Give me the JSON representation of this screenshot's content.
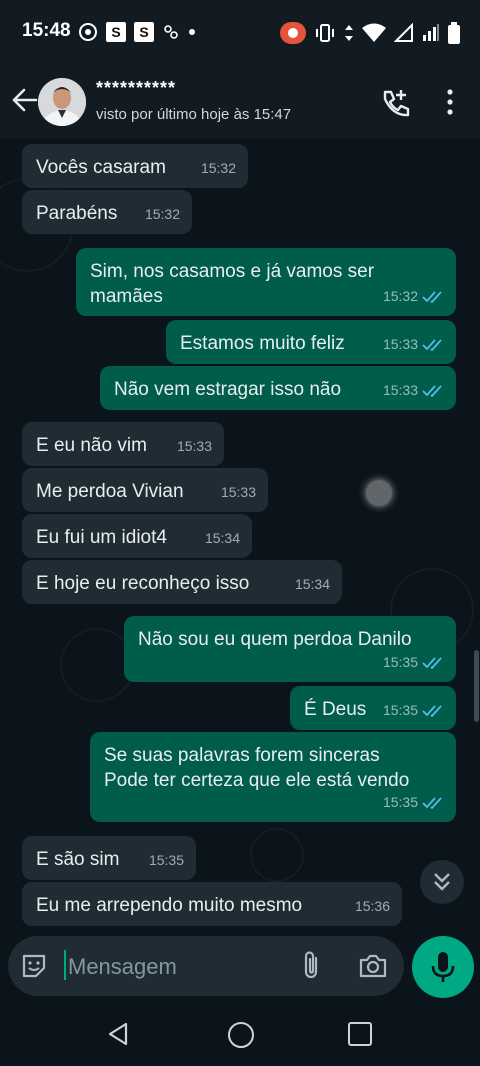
{
  "status_bar": {
    "time": "15:48",
    "box1": "S",
    "box2": "S"
  },
  "header": {
    "contact_name": "**********",
    "last_seen": "visto por último hoje às 15:47"
  },
  "messages": [
    {
      "dir": "in",
      "text": "Vocês casaram",
      "time": "15:32"
    },
    {
      "dir": "in",
      "text": "Parabéns",
      "time": "15:32"
    },
    {
      "dir": "out",
      "text": "Sim, nos casamos e já vamos ser mamães",
      "time": "15:32"
    },
    {
      "dir": "out",
      "text": "Estamos muito feliz",
      "time": "15:33"
    },
    {
      "dir": "out",
      "text": "Não vem estragar isso não",
      "time": "15:33"
    },
    {
      "dir": "in",
      "text": "E eu não vim",
      "time": "15:33"
    },
    {
      "dir": "in",
      "text": "Me perdoa Vivian",
      "time": "15:33"
    },
    {
      "dir": "in",
      "text": "Eu fui um idiot4",
      "time": "15:34"
    },
    {
      "dir": "in",
      "text": "E hoje eu reconheço isso",
      "time": "15:34"
    },
    {
      "dir": "out",
      "text": "Não sou eu quem perdoa Danilo",
      "time": "15:35"
    },
    {
      "dir": "out",
      "text": "É Deus",
      "time": "15:35"
    },
    {
      "dir": "out",
      "text": "Se suas palavras forem sinceras\nPode ter certeza que ele está vendo",
      "time": "15:35"
    },
    {
      "dir": "in",
      "text": "E são sim",
      "time": "15:35"
    },
    {
      "dir": "in",
      "text": "Eu me arrependo muito mesmo",
      "time": "15:36"
    }
  ],
  "composer": {
    "placeholder": "Mensagem"
  },
  "colors": {
    "incoming": "#202c33",
    "outgoing": "#005c4b",
    "accent": "#00a884",
    "read_ticks": "#53bdeb"
  },
  "icons": [
    "back-arrow-icon",
    "add-call-icon",
    "more-vert-icon",
    "sticker-icon",
    "attach-icon",
    "camera-icon",
    "mic-icon",
    "scroll-down-icon"
  ]
}
